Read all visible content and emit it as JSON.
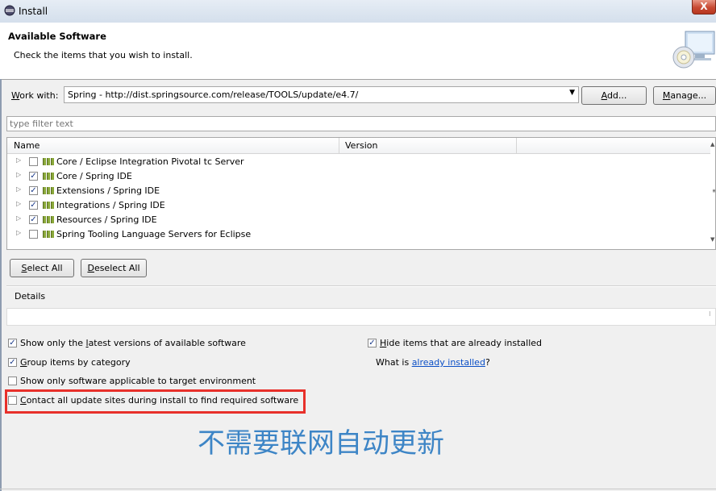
{
  "window": {
    "title": "Install",
    "close_glyph": "X"
  },
  "header": {
    "title": "Available Software",
    "subtitle": "Check the items that you wish to install."
  },
  "work_with": {
    "label_mnemonic": "W",
    "label_rest": "ork with:",
    "value": "Spring - http://dist.springsource.com/release/TOOLS/update/e4.7/",
    "add_mnemonic": "A",
    "add_rest": "dd...",
    "manage_mnemonic": "M",
    "manage_rest": "anage..."
  },
  "filter": {
    "placeholder": "type filter text"
  },
  "tree": {
    "columns": [
      "Name",
      "Version"
    ],
    "rows": [
      {
        "label": "Core / Eclipse Integration Pivotal tc Server",
        "checked": false
      },
      {
        "label": "Core / Spring IDE",
        "checked": true
      },
      {
        "label": "Extensions / Spring IDE",
        "checked": true
      },
      {
        "label": "Integrations / Spring IDE",
        "checked": true
      },
      {
        "label": "Resources / Spring IDE",
        "checked": true
      },
      {
        "label": "Spring Tooling Language Servers for Eclipse",
        "checked": false
      }
    ]
  },
  "buttons": {
    "select_all_mnemonic": "S",
    "select_all_rest": "elect All",
    "deselect_all_mnemonic": "D",
    "deselect_all_rest": "eselect All"
  },
  "details": {
    "label": "Details"
  },
  "options": {
    "latest_pre": "Show only the ",
    "latest_mnemonic": "l",
    "latest_post": "atest versions of available software",
    "latest_checked": true,
    "group_mnemonic": "G",
    "group_post": "roup items by category",
    "group_checked": true,
    "target_label": "Show only software applicable to target environment",
    "target_checked": false,
    "contact_mnemonic": "C",
    "contact_post": "ontact all update sites during install to find required software",
    "contact_checked": false,
    "hide_mnemonic": "H",
    "hide_post": "ide items that are already installed",
    "hide_checked": true,
    "whatis_pre": "What is ",
    "whatis_link": "already installed",
    "whatis_post": "?"
  },
  "annotation": "不需要联网自动更新",
  "check_glyph": "✓",
  "colors": {
    "highlight": "#e8302a",
    "annotation": "#3d85c6",
    "link": "#0b4fc6"
  }
}
